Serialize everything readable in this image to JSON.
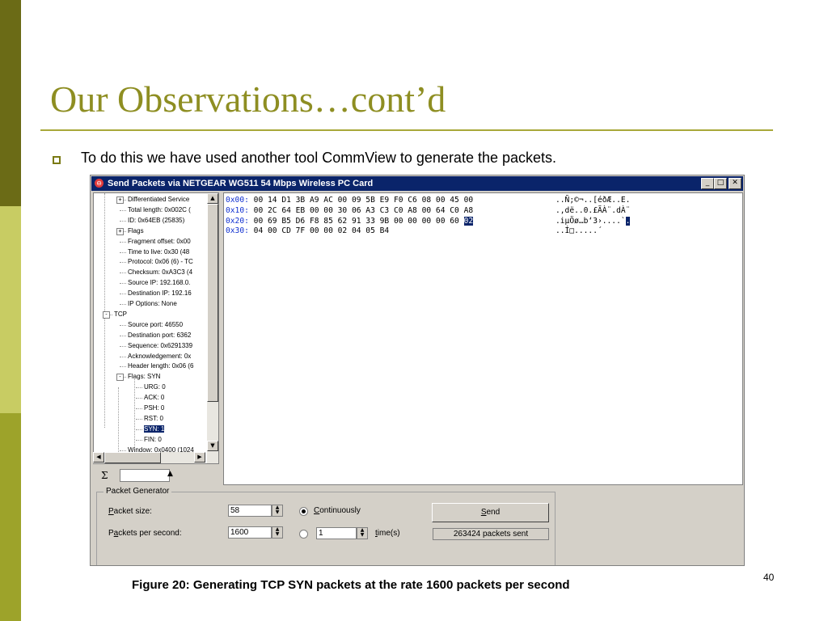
{
  "slide": {
    "title": "Our Observations…cont’d",
    "bullet": "To do this we have used another tool CommView to generate the packets.",
    "caption": "Figure 20: Generating TCP SYN packets at the rate 1600 packets per second",
    "page_number": "40"
  },
  "window": {
    "title": "Send Packets via  NETGEAR WG511 54 Mbps Wireless PC Card",
    "icon": "stop-sign-icon",
    "controls": [
      "minimize",
      "maximize",
      "close"
    ]
  },
  "tree": {
    "items": [
      {
        "label": "Differentiated Service",
        "level": 1,
        "expander": "+"
      },
      {
        "label": "Total length: 0x002C (",
        "level": 1
      },
      {
        "label": "ID: 0x64EB (25835)",
        "level": 1
      },
      {
        "label": "Flags",
        "level": 1,
        "expander": "+"
      },
      {
        "label": "Fragment offset: 0x00",
        "level": 1
      },
      {
        "label": "Time to live: 0x30 (48",
        "level": 1
      },
      {
        "label": "Protocol: 0x06 (6) - TC",
        "level": 1
      },
      {
        "label": "Checksum: 0xA3C3 (4",
        "level": 1
      },
      {
        "label": "Source IP: 192.168.0.",
        "level": 1
      },
      {
        "label": "Destination IP: 192.16",
        "level": 1
      },
      {
        "label": "IP Options: None",
        "level": 1
      },
      {
        "label": "TCP",
        "level": 0,
        "expander": "-"
      },
      {
        "label": "Source port: 46550",
        "level": 1
      },
      {
        "label": "Destination port: 6362",
        "level": 1
      },
      {
        "label": "Sequence: 0x6291339",
        "level": 1
      },
      {
        "label": "Acknowledgement: 0x",
        "level": 1
      },
      {
        "label": "Header length: 0x06 (6",
        "level": 1
      },
      {
        "label": "Flags: SYN",
        "level": 1,
        "expander": "-"
      },
      {
        "label": "URG: 0",
        "level": 2
      },
      {
        "label": "ACK: 0",
        "level": 2
      },
      {
        "label": "PSH: 0",
        "level": 2
      },
      {
        "label": "RST: 0",
        "level": 2
      },
      {
        "label": "SYN: 1",
        "level": 2,
        "selected": true
      },
      {
        "label": "FIN: 0",
        "level": 2
      },
      {
        "label": "Window: 0x0400 (1024",
        "level": 1
      }
    ]
  },
  "toolstrip": {
    "sigma_icon": "Σ",
    "up_arrow": "▲"
  },
  "hex": {
    "rows": [
      {
        "offset": "0x00:",
        "bytes": "00 14 D1 3B A9 AC 00 09 5B E9 F0 C6 08 00 45 00",
        "ascii": "..Ñ;©¬..[éðÆ..E."
      },
      {
        "offset": "0x10:",
        "bytes": "00 2C 64 EB 00 00 30 06 A3 C3 C0 A8 00 64 C0 A8",
        "ascii": ".,dë..0.£ÃÀ¨.dÀ¨"
      },
      {
        "offset": "0x20:",
        "bytes": "00 69 B5 D6 F8 85 62 91 33 9B 00 00 00 00 60 ",
        "highlight_byte": "02",
        "ascii": ".iµÖø…b‘3›....`",
        "highlight_char": "."
      },
      {
        "offset": "0x30:",
        "bytes": "04 00 CD 7F 00 00 02 04 05 B4",
        "ascii": "..Í□.....´"
      }
    ]
  },
  "packet_generator": {
    "legend": "Packet Generator",
    "packet_size_label": "Packet size:",
    "packet_size_value": "58",
    "pps_label": "Packets per second:",
    "pps_value": "1600",
    "continuously_label": "Continuously",
    "times_value": "1",
    "times_label": "time(s)",
    "send_label": "Send",
    "status": "263424 packets sent",
    "mode": "continuously"
  },
  "colors": {
    "accent_dark": "#6b6b16",
    "accent_light": "#c8cc63",
    "title_color": "#8e8e22",
    "titlebar": "#0a246a"
  }
}
